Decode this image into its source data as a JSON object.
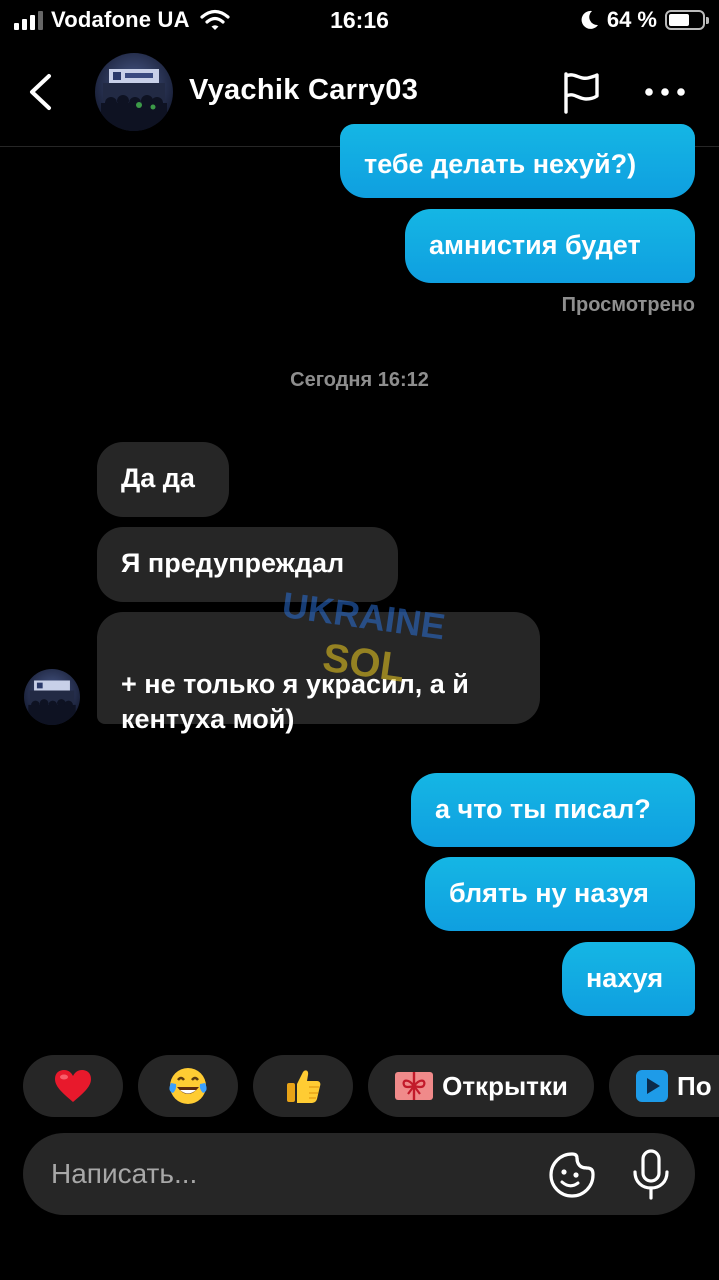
{
  "status_bar": {
    "carrier": "Vodafone UA",
    "time": "16:16",
    "battery_text": "64 %",
    "battery_level": 0.64,
    "icons": [
      "signal-icon",
      "wifi-icon",
      "moon-icon",
      "battery-icon"
    ]
  },
  "header": {
    "contact_name": "Vyachik Carry03",
    "icons": [
      "back-chevron-icon",
      "flag-icon",
      "more-dots-icon"
    ]
  },
  "messages": [
    {
      "direction": "outgoing",
      "text": "тебе делать нехуй?)"
    },
    {
      "direction": "outgoing",
      "text": "амнистия будет"
    },
    {
      "direction": "incoming",
      "text": "Да да"
    },
    {
      "direction": "incoming",
      "text": "Я предупреждал"
    },
    {
      "direction": "incoming",
      "text": "+ не только я украсил, а й\nкентуха мой)"
    },
    {
      "direction": "outgoing",
      "text": "а что ты писал?"
    },
    {
      "direction": "outgoing",
      "text": "блять ну назуя"
    },
    {
      "direction": "outgoing",
      "text": "нахуя"
    }
  ],
  "seen_label": "Просмотрено",
  "date_separator": "Сегодня 16:12",
  "watermark": {
    "line1": "UKRAINE",
    "line2": "SOL"
  },
  "quick_replies": [
    {
      "icon": "red-heart-emoji",
      "label": ""
    },
    {
      "icon": "tears-of-joy-emoji",
      "label": ""
    },
    {
      "icon": "thumbs-up-emoji",
      "label": ""
    },
    {
      "icon": "gift-card-icon",
      "label": "Открытки"
    },
    {
      "icon": "play-icon",
      "label": "По"
    }
  ],
  "composer": {
    "placeholder": "Написать...",
    "icons": [
      "sticker-icon",
      "microphone-icon"
    ]
  },
  "colors": {
    "background": "#000000",
    "outgoing_bubble": "#0f9fe0",
    "incoming_bubble": "#262626",
    "secondary_text": "#8e8e8e"
  }
}
